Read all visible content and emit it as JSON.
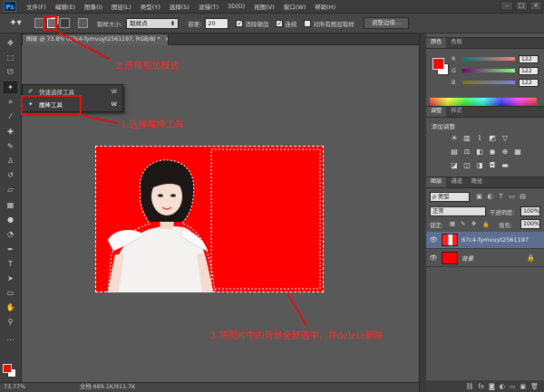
{
  "app": {
    "logo": "Ps"
  },
  "menu": [
    "文件(F)",
    "编辑(E)",
    "图像(I)",
    "图层(L)",
    "类型(Y)",
    "选择(S)",
    "滤镜(T)",
    "3D(D)",
    "视图(V)",
    "窗口(W)",
    "帮助(H)"
  ],
  "window_controls": {
    "minimize": "–",
    "maximize": "□",
    "close": "×"
  },
  "options": {
    "sample_size_label": "取样大小:",
    "sample_size_value": "取样点",
    "tolerance_label": "容差:",
    "tolerance_value": "20",
    "antialias_label": "消除锯齿",
    "contiguous_label": "连续",
    "all_layers_label": "对所有图层取样",
    "refine_edge_button": "调整边缘..."
  },
  "document": {
    "tab_title": "图层 @ 73.8% (67c4-fymvuyt2561197, RGB/8) *",
    "close": "×"
  },
  "flyout": {
    "items": [
      {
        "label": "快速选择工具",
        "shortcut": "W"
      },
      {
        "label": "魔棒工具",
        "shortcut": "W"
      }
    ]
  },
  "annotations": {
    "step1": "1.选择魔棒工具",
    "step2": "2.选择相加模式",
    "step3": "3.将图片中的背景全部选中，并delete删除"
  },
  "status": {
    "zoom": "73.77%",
    "doc_size": "文档:689.1K/911.7K"
  },
  "panels": {
    "color_tabs": [
      "颜色",
      "色板"
    ],
    "color": {
      "r": {
        "label": "R",
        "value": "122"
      },
      "g": {
        "label": "G",
        "value": "122"
      },
      "b": {
        "label": "B",
        "value": "122"
      },
      "foreground": "#ff0000",
      "background": "#ffffff"
    },
    "adjust_tabs": [
      "调整",
      "样式"
    ],
    "adjust_title": "添加调整",
    "layers_tabs": [
      "图层",
      "通道",
      "路径"
    ],
    "layers": {
      "filter_kind": "ρ 类型",
      "blend_mode": "正常",
      "opacity_label": "不透明度:",
      "opacity_value": "100%",
      "lock_label": "锁定:",
      "fill_label": "填充:",
      "fill_value": "100%",
      "rows": [
        {
          "name": "67c4-fymvuyt2561197",
          "selected": true
        },
        {
          "name": "背景",
          "selected": false,
          "locked": true
        }
      ]
    }
  },
  "colors": {
    "accent_red": "#e01010",
    "canvas_red": "#ff0000",
    "selected_layer": "#5d7091"
  }
}
